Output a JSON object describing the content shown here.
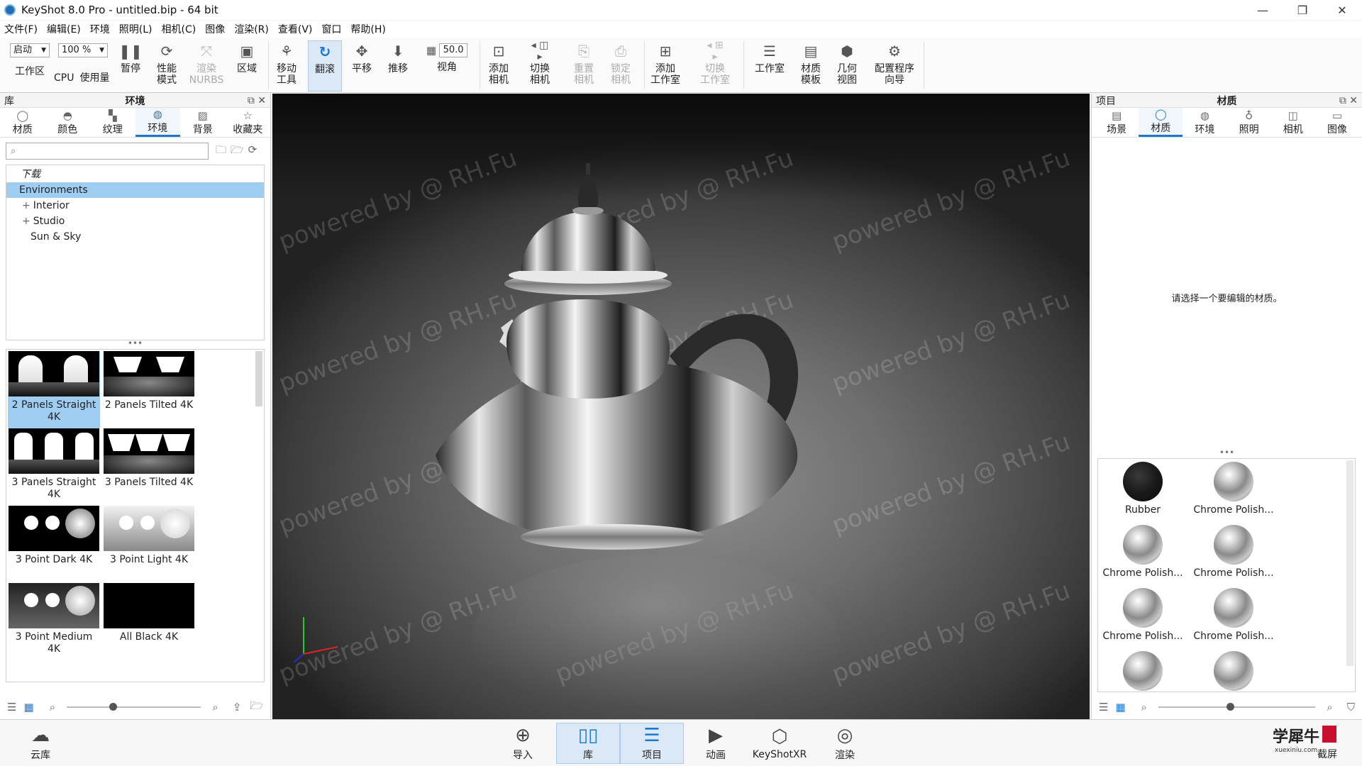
{
  "window": {
    "title": "KeyShot 8.0 Pro  - untitled.bip  - 64 bit",
    "controls": [
      "—",
      "❐",
      "✕"
    ]
  },
  "menu": [
    "文件(F)",
    "编辑(E)",
    "环境",
    "照明(L)",
    "相机(C)",
    "图像",
    "渲染(R)",
    "查看(V)",
    "窗口",
    "帮助(H)"
  ],
  "toolbar": {
    "start_select": "启动",
    "cpu_select": "100 %",
    "fov_value": "50.0",
    "buttons": {
      "workspace": "工作区",
      "cpu": "CPU",
      "usage": "使用量",
      "pause": "暂停",
      "performance": "性能\n模式",
      "render_nurbs": "渲染\nNURBS",
      "region": "区域",
      "move_tool": "移动\n工具",
      "tumble": "翻滚",
      "pan": "平移",
      "dolly": "推移",
      "view_angle": "视角",
      "add_camera": "添加\n相机",
      "switch_camera": "切换\n相机",
      "reset_camera": "重置\n相机",
      "lock_camera": "锁定\n相机",
      "add_studio": "添加\n工作室",
      "switch_studio": "切换\n工作室",
      "studio": "工作室",
      "material_template": "材质\n模板",
      "geometry_view": "几何\n视图",
      "config_wizard": "配置程序\n向导"
    }
  },
  "library": {
    "header_left": "库",
    "header_title": "环境",
    "tabs": [
      "材质",
      "颜色",
      "纹理",
      "环境",
      "背景",
      "收藏夹"
    ],
    "active_tab": "环境",
    "search_placeholder": "",
    "tree": {
      "download": "下载",
      "environments": "Environments",
      "interior": "Interior",
      "studio": "Studio",
      "sun_sky": "Sun & Sky"
    },
    "thumbnails": [
      {
        "label": "2 Panels Straight 4K",
        "selected": true
      },
      {
        "label": "2 Panels Tilted 4K",
        "selected": false
      },
      {
        "label": "3 Panels Straight 4K",
        "selected": false
      },
      {
        "label": "3 Panels Tilted 4K",
        "selected": false
      },
      {
        "label": "3 Point Dark 4K",
        "selected": false
      },
      {
        "label": "3 Point Light 4K",
        "selected": false
      },
      {
        "label": "3 Point Medium 4K",
        "selected": false
      },
      {
        "label": "All Black 4K",
        "selected": false
      }
    ]
  },
  "viewport": {
    "watermark": "powered by @ RH.Fu"
  },
  "project": {
    "header_left": "项目",
    "header_title": "材质",
    "tabs": [
      "场景",
      "材质",
      "环境",
      "照明",
      "相机",
      "图像"
    ],
    "active_tab": "材质",
    "hint": "请选择一个要编辑的材质。",
    "materials": [
      "Rubber",
      "Chrome Polish...",
      "Chrome Polish...",
      "Chrome Polish...",
      "Chrome Polish...",
      "Chrome Polish...",
      "",
      ""
    ]
  },
  "bottombar": {
    "cloud": "云库",
    "import": "导入",
    "library": "库",
    "project": "项目",
    "animation": "动画",
    "keyshotxr": "KeyShotXR",
    "render": "渲染",
    "screenshot": "截屏"
  },
  "logo": {
    "main": "学犀牛",
    "sub": "xuexiniu.com"
  },
  "colors": {
    "accent": "#1b78d0",
    "selection": "#9fcdf2"
  }
}
